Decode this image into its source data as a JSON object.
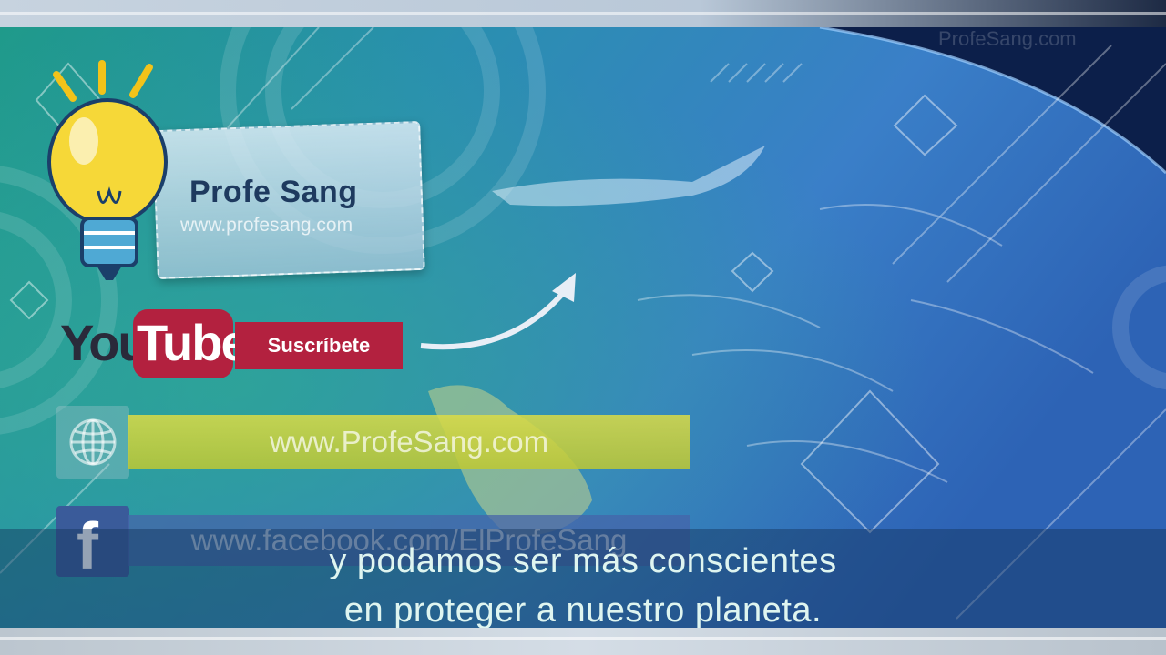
{
  "brand": {
    "name": "Profe Sang",
    "url": "www.profesang.com",
    "watermark": "ProfeSang.com"
  },
  "youtube": {
    "logo_you": "You",
    "logo_tube": "Tube",
    "subscribe_label": "Suscríbete"
  },
  "links": {
    "website_label": "www.ProfeSang.com",
    "website_icon": "globe-icon",
    "facebook_label": "www.facebook.com/ElProfeSang",
    "facebook_icon": "facebook-icon"
  },
  "subtitles": {
    "line1": "y podamos ser más conscientes",
    "line2": "en proteger a nuestro planeta."
  },
  "colors": {
    "youtube_red": "#b3213f",
    "website_bar": "#c8cc3c",
    "facebook_blue": "#3a5b9a",
    "subtitle_text": "#dff5f0"
  }
}
